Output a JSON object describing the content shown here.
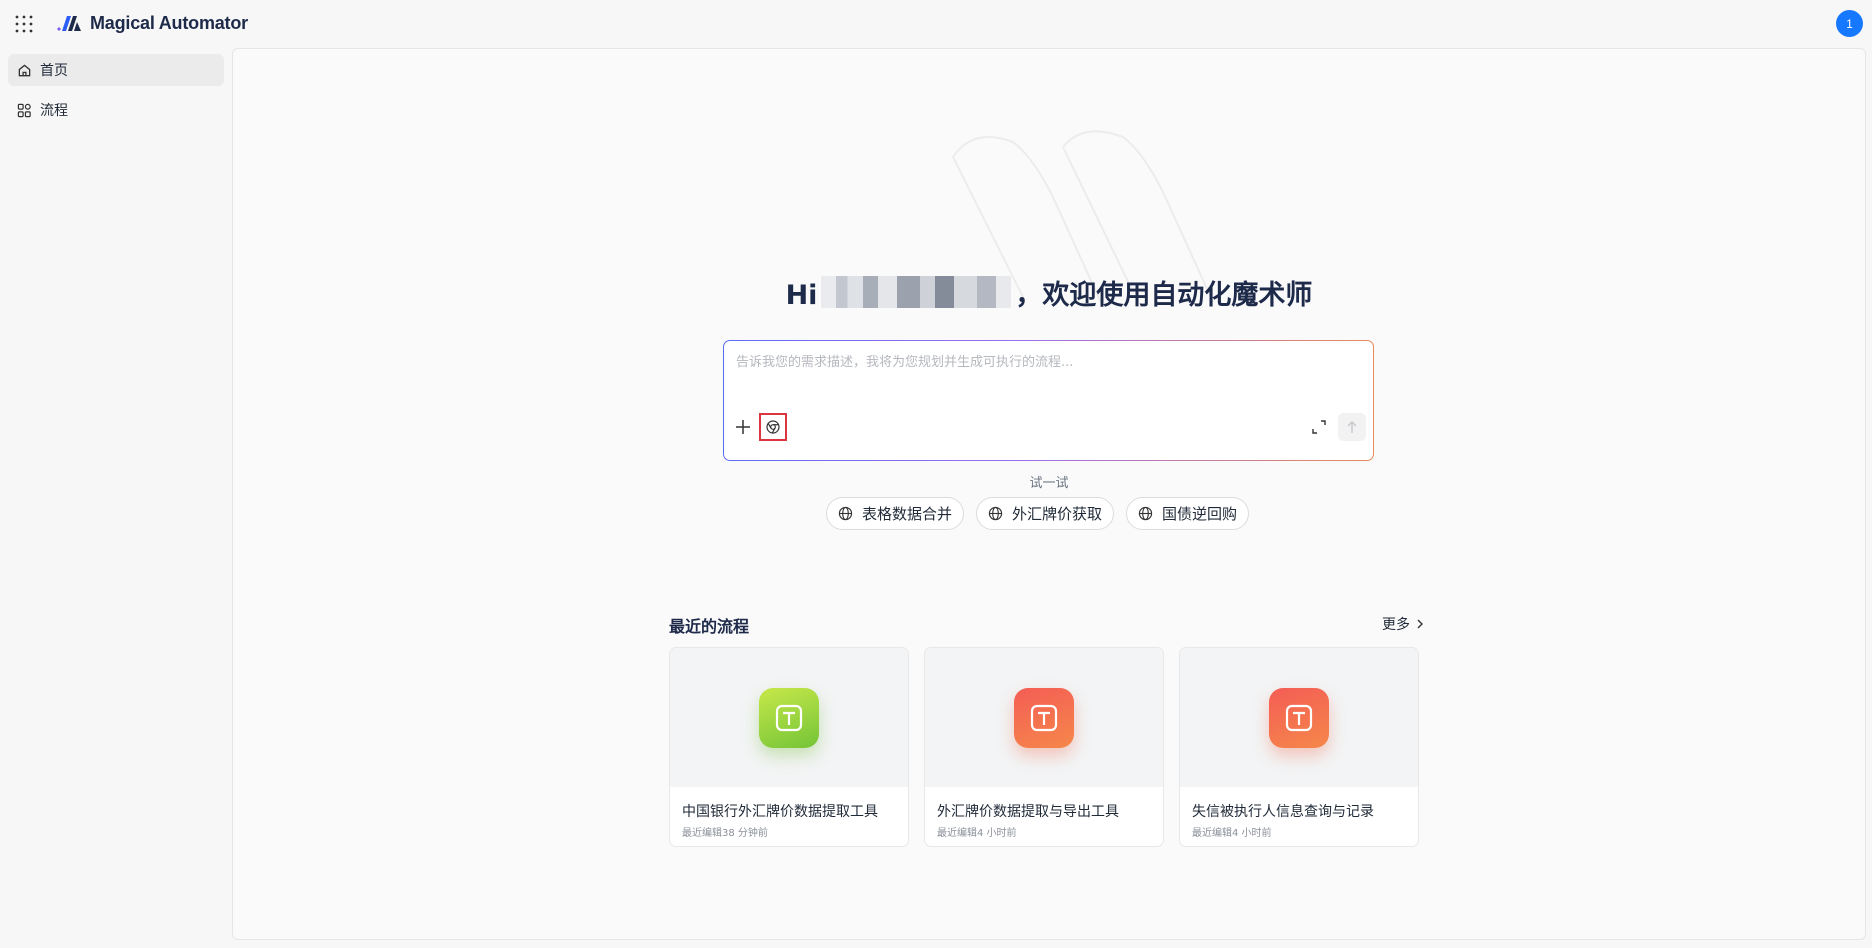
{
  "app": {
    "title": "Magical Automator",
    "user_badge": "1"
  },
  "sidebar": {
    "items": [
      {
        "label": "首页",
        "icon": "home-icon",
        "active": true
      },
      {
        "label": "流程",
        "icon": "grid-icon",
        "active": false
      }
    ]
  },
  "main": {
    "greeting_prefix": "Hi",
    "greeting_suffix": "，欢迎使用自动化魔术师",
    "input": {
      "placeholder": "告诉我您的需求描述，我将为您规划并生成可执行的流程..."
    },
    "try_label": "试一试",
    "suggestions": [
      {
        "label": "表格数据合并",
        "icon": "globe-icon"
      },
      {
        "label": "外汇牌价获取",
        "icon": "globe-icon"
      },
      {
        "label": "国债逆回购",
        "icon": "globe-icon"
      }
    ],
    "recent": {
      "title": "最近的流程",
      "more_label": "更多",
      "cards": [
        {
          "name": "中国银行外汇牌价数据提取工具",
          "time": "最近编辑38 分钟前",
          "color": "green"
        },
        {
          "name": "外汇牌价数据提取与导出工具",
          "time": "最近编辑4 小时前",
          "color": "orange"
        },
        {
          "name": "失信被执行人信息查询与记录",
          "time": "最近编辑4 小时前",
          "color": "orange"
        }
      ]
    }
  },
  "colors": {
    "accent": "#1677ff",
    "heading": "#1e2a4a",
    "highlight_border": "#d9363e"
  }
}
